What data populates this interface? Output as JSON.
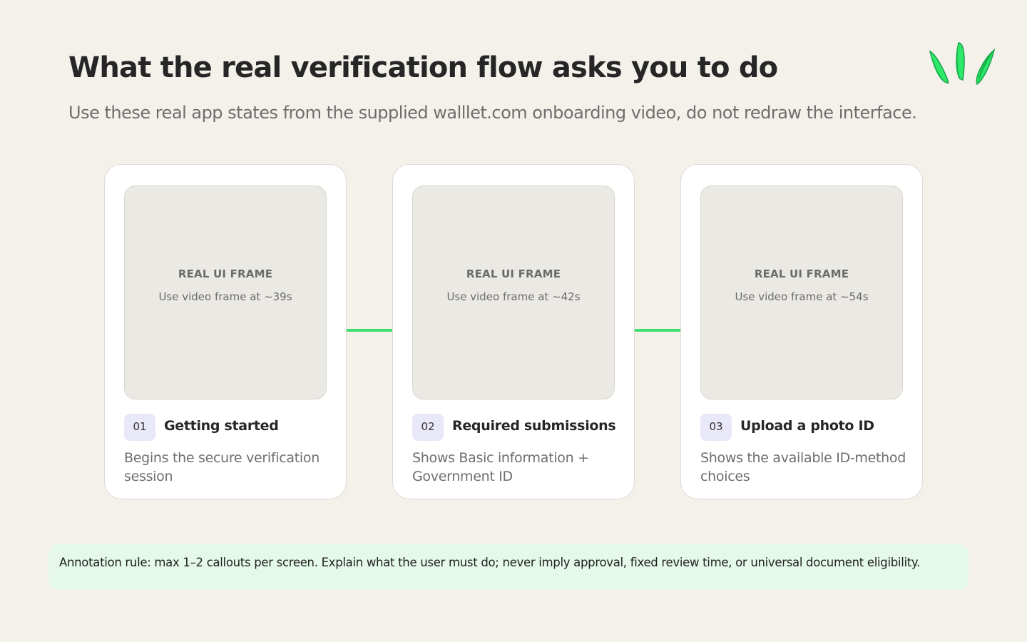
{
  "header": {
    "title": "What the real verification flow asks you to do",
    "subtitle": "Use these real app states from the supplied walllet.com onboarding video, do not redraw the interface."
  },
  "colors": {
    "background": "#f4f1eb",
    "accent": "#3ce06a",
    "badge": "#e9e8f8",
    "annotation_bg": "#e4f9ea"
  },
  "steps": [
    {
      "number": "01",
      "frame_label": "REAL UI FRAME",
      "frame_note": "Use video frame at ~39s",
      "title": "Getting started",
      "description": "Begins the secure verification session"
    },
    {
      "number": "02",
      "frame_label": "REAL UI FRAME",
      "frame_note": "Use video frame at ~42s",
      "title": "Required submissions",
      "description": "Shows Basic information + Government ID"
    },
    {
      "number": "03",
      "frame_label": "REAL UI FRAME",
      "frame_note": "Use video frame at ~54s",
      "title": "Upload a photo ID",
      "description": "Shows the available ID-method choices"
    }
  ],
  "annotation": "Annotation rule: max 1–2 callouts per screen. Explain what the user must do; never imply approval, fixed review time, or universal document eligibility."
}
